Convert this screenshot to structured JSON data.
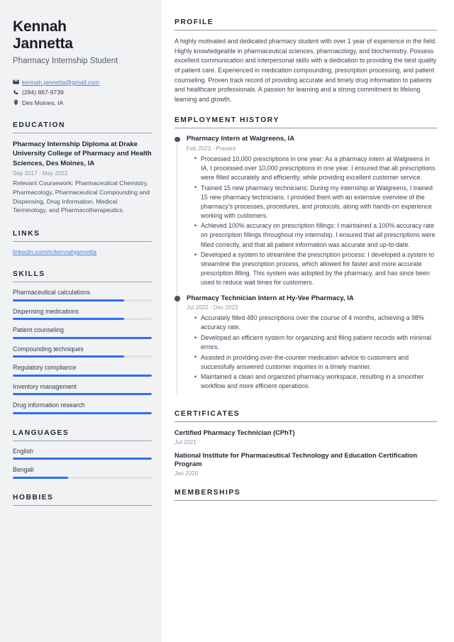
{
  "sidebar": {
    "name_line1": "Kennah",
    "name_line2": "Jannetta",
    "job_title": "Pharmacy Internship Student",
    "contact": {
      "email": "kennah.jannetta@gmail.com",
      "phone": "(284) 867-9739",
      "location": "Des Moines, IA"
    },
    "education": {
      "heading": "EDUCATION",
      "entries": [
        {
          "title": "Pharmacy Internship Diploma at Drake University College of Pharmacy and Health Sciences, Des Moines, IA",
          "date": "Sep 2017 - May 2022",
          "description": "Relevant Coursework: Pharmaceutical Chemistry, Pharmacology, Pharmaceutical Compounding and Dispensing, Drug Information, Medical Terminology, and Pharmacotherapeutics."
        }
      ]
    },
    "links": {
      "heading": "LINKS",
      "items": [
        {
          "label": "linkedin.com/in/kennahjannetta"
        }
      ]
    },
    "skills": {
      "heading": "SKILLS",
      "items": [
        {
          "label": "Pharmaceutical calculations",
          "level": 80
        },
        {
          "label": "Dispensing medications",
          "level": 80
        },
        {
          "label": "Patient counseling",
          "level": 100
        },
        {
          "label": "Compounding techniques",
          "level": 80
        },
        {
          "label": "Regulatory compliance",
          "level": 100
        },
        {
          "label": "Inventory management",
          "level": 100
        },
        {
          "label": "Drug information research",
          "level": 100
        }
      ]
    },
    "languages": {
      "heading": "LANGUAGES",
      "items": [
        {
          "label": "English",
          "level": 100
        },
        {
          "label": "Bengali",
          "level": 40
        }
      ]
    },
    "hobbies": {
      "heading": "HOBBIES"
    }
  },
  "main": {
    "profile": {
      "heading": "PROFILE",
      "text": "A highly motivated and dedicated pharmacy student with over 1 year of experience in the field. Highly knowledgeable in pharmaceutical sciences, pharmacology, and biochemistry. Possess excellent communication and interpersonal skills with a dedication to providing the best quality of patient care. Experienced in medication compounding, prescription processing, and patient counseling. Proven track record of providing accurate and timely drug information to patients and healthcare professionals. A passion for learning and a strong commitment to lifelong learning and growth."
    },
    "employment": {
      "heading": "EMPLOYMENT HISTORY",
      "jobs": [
        {
          "title": "Pharmacy Intern at Walgreens, IA",
          "date": "Feb 2023 - Present",
          "bullets": [
            "Processed 10,000 prescriptions in one year: As a pharmacy intern at Walgreens in IA, I processed over 10,000 prescriptions in one year. I ensured that all prescriptions were filled accurately and efficiently, while providing excellent customer service.",
            "Trained 15 new pharmacy technicians: During my internship at Walgreens, I trained 15 new pharmacy technicians. I provided them with an extensive overview of the pharmacy's processes, procedures, and protocols, along with hands-on experience working with customers.",
            "Achieved 100% accuracy on prescription fillings: I maintained a 100% accuracy rate on prescription fillings throughout my internship. I ensured that all prescriptions were filled correctly, and that all patient information was accurate and up-to-date.",
            "Developed a system to streamline the prescription process: I developed a system to streamline the prescription process, which allowed for faster and more accurate prescription filling. This system was adopted by the pharmacy, and has since been used to reduce wait times for customers."
          ]
        },
        {
          "title": "Pharmacy Technician Intern at Hy-Vee Pharmacy, IA",
          "date": "Jul 2022 - Dec 2022",
          "bullets": [
            "Accurately filled 480 prescriptions over the course of 4 months, achieving a 98% accuracy rate.",
            "Developed an efficient system for organizing and filing patient records with minimal errors.",
            "Assisted in providing over-the-counter medication advice to customers and successfully answered customer inquiries in a timely manner.",
            "Maintained a clean and organized pharmacy workspace, resulting in a smoother workflow and more efficient operations."
          ]
        }
      ]
    },
    "certificates": {
      "heading": "CERTIFICATES",
      "items": [
        {
          "title": "Certified Pharmacy Technician (CPhT)",
          "date": "Jul 2021"
        },
        {
          "title": "National Institute for Pharmaceutical Technology and Education Certification Program",
          "date": "Jan 2020"
        }
      ]
    },
    "memberships": {
      "heading": "MEMBERSHIPS"
    }
  },
  "colors": {
    "sidebar_bg": "#f1f2f4",
    "accent_blue": "#2d6df6",
    "link_blue": "#4a7fe0",
    "heading": "#1f2430",
    "muted": "#8d93a1"
  }
}
